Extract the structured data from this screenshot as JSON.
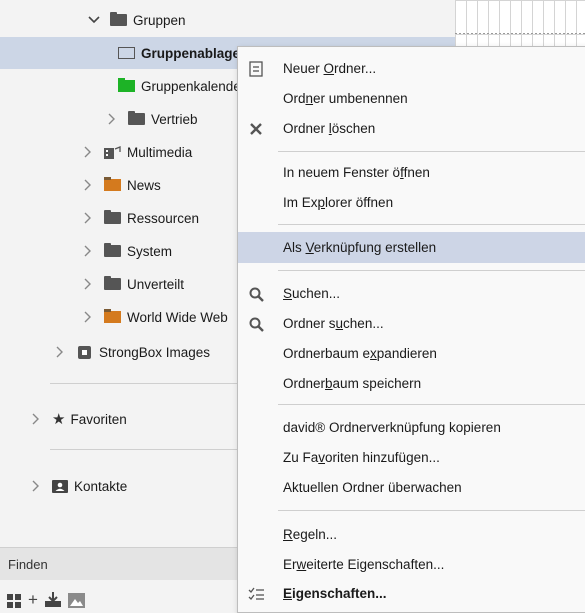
{
  "tree": {
    "items": [
      {
        "label": "Gruppen"
      },
      {
        "label": "Gruppenablage"
      },
      {
        "label": "Gruppenkalender"
      },
      {
        "label": "Vertrieb"
      },
      {
        "label": "Multimedia"
      },
      {
        "label": "News"
      },
      {
        "label": "Ressourcen"
      },
      {
        "label": "System"
      },
      {
        "label": "Unverteilt"
      },
      {
        "label": "World Wide Web"
      },
      {
        "label": "StrongBox Images"
      }
    ],
    "favoriten": "Favoriten",
    "kontakte": "Kontakte",
    "finden": "Finden"
  },
  "menu": {
    "items": [
      {
        "pre": "Neuer ",
        "u": "O",
        "post": "rdner..."
      },
      {
        "pre": "Ord",
        "u": "n",
        "post": "er umbenennen"
      },
      {
        "pre": "Ordner ",
        "u": "l",
        "post": "öschen"
      },
      {
        "pre": "In neuem Fenster ö",
        "u": "f",
        "post": "fnen"
      },
      {
        "pre": "Im Ex",
        "u": "p",
        "post": "lorer öffnen"
      },
      {
        "pre": "Als ",
        "u": "V",
        "post": "erknüpfung erstellen"
      },
      {
        "pre": "",
        "u": "S",
        "post": "uchen..."
      },
      {
        "pre": "Ordner s",
        "u": "u",
        "post": "chen..."
      },
      {
        "pre": "Ordnerbaum e",
        "u": "x",
        "post": "pandieren"
      },
      {
        "pre": "Ordner",
        "u": "b",
        "post": "aum speichern"
      },
      {
        "pre": "david® Ordnerverknüpfung kopieren",
        "u": "",
        "post": ""
      },
      {
        "pre": "Zu Fa",
        "u": "v",
        "post": "oriten hinzufügen..."
      },
      {
        "pre": "Aktuellen Ordner überwachen",
        "u": "",
        "post": ""
      },
      {
        "pre": "",
        "u": "R",
        "post": "egeln..."
      },
      {
        "pre": "Er",
        "u": "w",
        "post": "eiterte Eigenschaften..."
      },
      {
        "pre": "",
        "u": "E",
        "post": "igenschaften..."
      }
    ]
  },
  "colors": {
    "accent_folder_green": "#1db326",
    "news_folder": "#d47a1e",
    "selection": "#ccd6e6",
    "menu_highlight": "#cdd5e6"
  }
}
